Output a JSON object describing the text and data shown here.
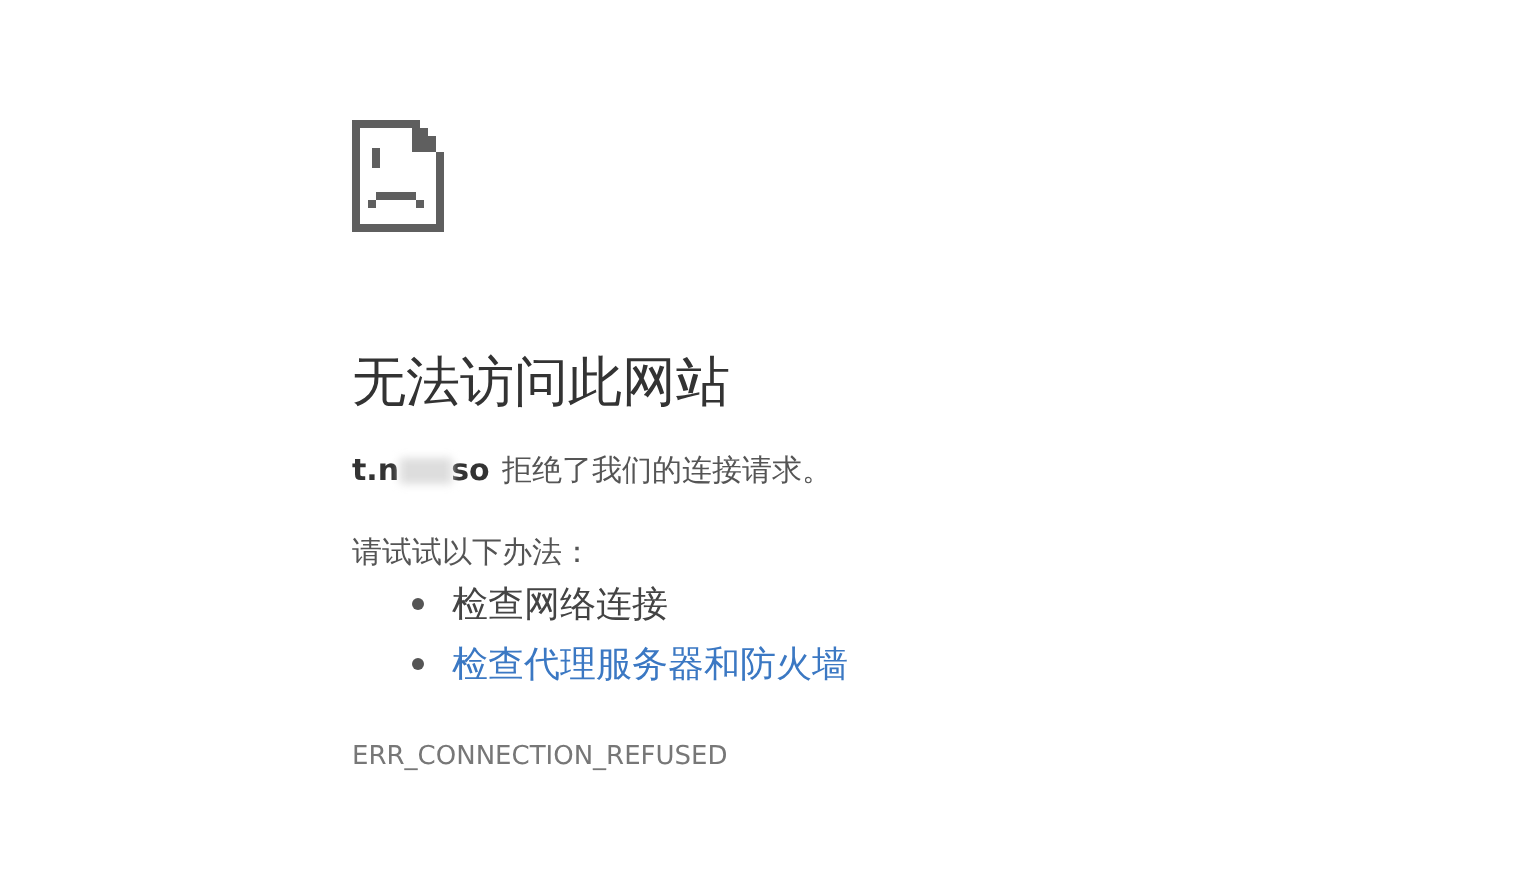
{
  "heading": "无法访问此网站",
  "message": {
    "host_start": "t.n",
    "host_end": "so",
    "text": "拒绝了我们的连接请求。"
  },
  "suggestions_title": "请试试以下办法：",
  "suggestions": [
    {
      "kind": "text",
      "label": "检查网络连接"
    },
    {
      "kind": "link",
      "label": "检查代理服务器和防火墙"
    }
  ],
  "error_code": "ERR_CONNECTION_REFUSED"
}
